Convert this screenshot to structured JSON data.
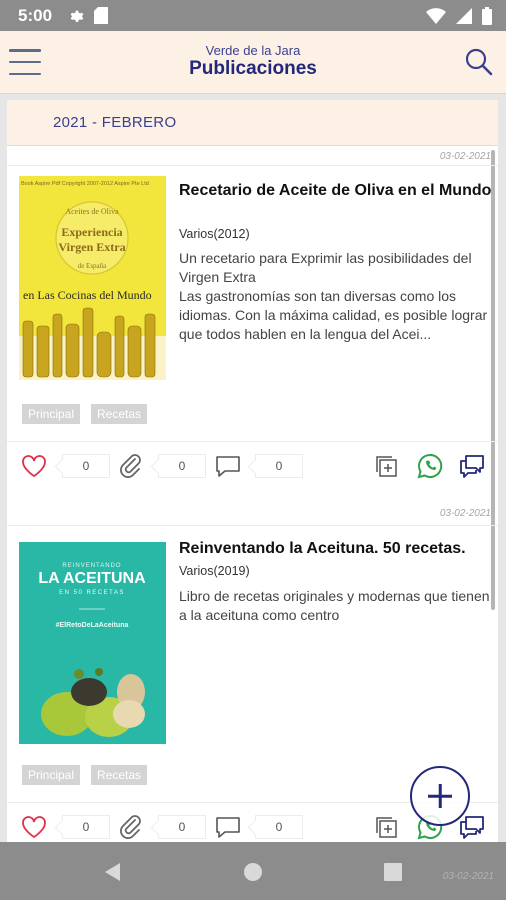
{
  "status_bar": {
    "time": "5:00"
  },
  "app_bar": {
    "subtitle": "Verde de la Jara",
    "title": "Publicaciones"
  },
  "section": {
    "month": "2021 - FEBRERO"
  },
  "publications": [
    {
      "date": "03-02-2021",
      "title": "Recetario de Aceite de Oliva en el Mundo",
      "author": "Varios(2012)",
      "description": "Un recetario para Exprimir las posibilidades del Virgen Extra\nLas gastronomías son tan diversas como los idiomas. Con la máxima calidad,  es posible lograr que todos hablen en la lengua del Acei...",
      "cover": {
        "top_line": "Book Aspire Pdf Copyright 2007-2012 Aspire Pte Ltd",
        "ring": "Aceites de Oliva",
        "line1": "Experiencia",
        "line2": "Virgen Extra",
        "ring_bottom": "de España",
        "banner": "en Las Cocinas del Mundo"
      },
      "tags": [
        "Principal",
        "Recetas"
      ],
      "likes": "0",
      "attachments": "0",
      "comments": "0"
    },
    {
      "date": "03-02-2021",
      "title": "Reinventando la Aceituna. 50 recetas.",
      "author": "Varios(2019)",
      "description": "Libro de recetas originales y modernas que tienen a la aceituna como centro",
      "cover": {
        "top_line": "REINVENTANDO",
        "main": "LA ACEITUNA",
        "sub": "EN 50 RECETAS",
        "hashtag": "#ElRetoDeLaAceituna"
      },
      "tags": [
        "Principal",
        "Recetas"
      ],
      "likes": "0",
      "attachments": "0",
      "comments": "0"
    }
  ],
  "footer_date": "03-02-2021",
  "colors": {
    "accent": "#23287a",
    "header_bg": "#fdf1e6",
    "like_red": "#e0304a",
    "whatsapp_green": "#2ea24a",
    "chat_blue": "#23287a"
  },
  "icons": [
    "menu-icon",
    "search-icon",
    "settings-icon",
    "sim-icon",
    "wifi-icon",
    "signal-icon",
    "battery-icon",
    "heart-icon",
    "paperclip-icon",
    "comment-icon",
    "add-copy-icon",
    "whatsapp-icon",
    "chat-icon",
    "plus-icon",
    "back-icon",
    "home-icon",
    "recents-icon"
  ]
}
